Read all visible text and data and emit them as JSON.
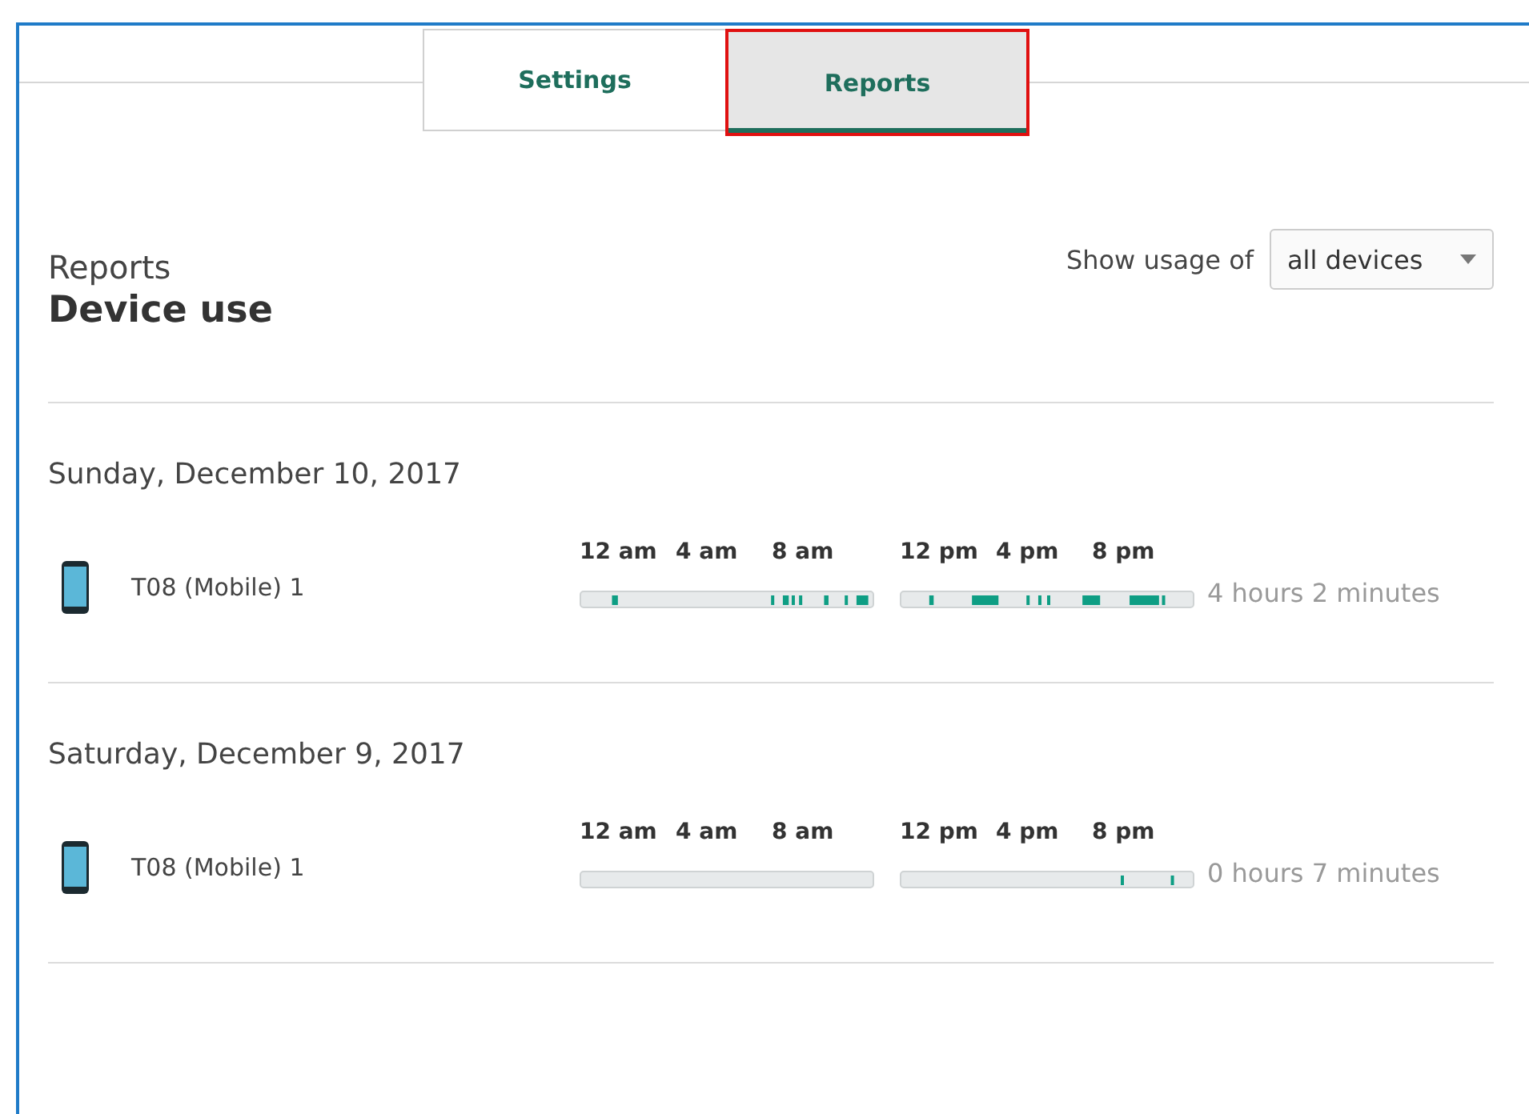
{
  "tabs": [
    {
      "label": "Settings",
      "selected": false
    },
    {
      "label": "Reports",
      "selected": true
    }
  ],
  "header": {
    "section": "Reports",
    "title": "Device use"
  },
  "filter": {
    "label": "Show usage of",
    "value": "all devices"
  },
  "days": [
    {
      "date": "Sunday, December 10, 2017",
      "am_labels": [
        "12 am",
        "4 am",
        "8 am"
      ],
      "pm_labels": [
        "12 pm",
        "4 pm",
        "8 pm"
      ],
      "device": "T08 (Mobile) 1",
      "total": "4 hours 2 minutes"
    },
    {
      "date": "Saturday, December 9, 2017",
      "am_labels": [
        "12 am",
        "4 am",
        "8 am"
      ],
      "pm_labels": [
        "12 pm",
        "4 pm",
        "8 pm"
      ],
      "device": "T08 (Mobile) 1",
      "total": "0 hours 7 minutes"
    }
  ]
}
